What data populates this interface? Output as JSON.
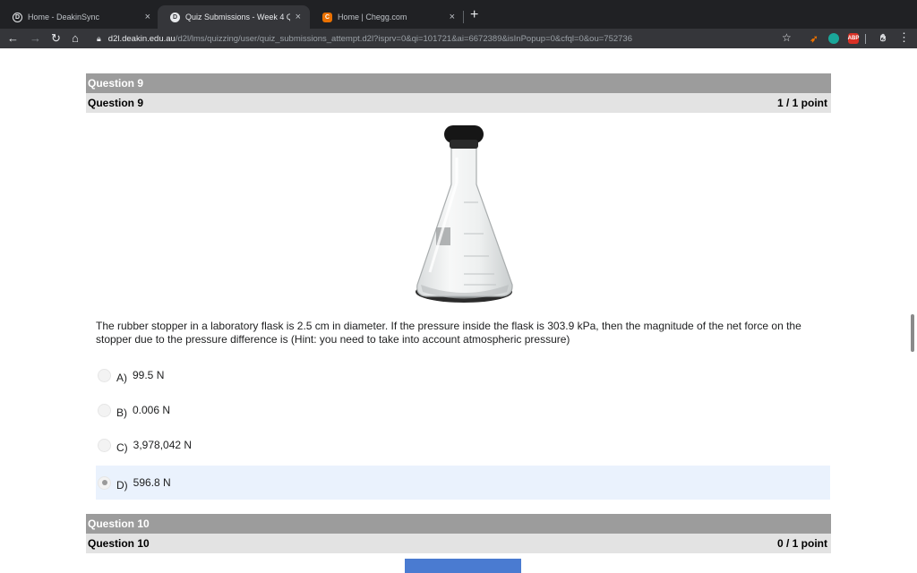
{
  "browser": {
    "tabs": [
      {
        "title": "Home - DeakinSync",
        "close": "×"
      },
      {
        "title": "Quiz Submissions - Week 4 Qu",
        "close": "×"
      },
      {
        "title": "Home | Chegg.com",
        "close": "×"
      }
    ],
    "new_tab": "+",
    "url_host": "d2l.deakin.edu.au",
    "url_path": "/d2l/lms/quizzing/user/quiz_submissions_attempt.d2l?isprv=0&qi=101721&ai=6672389&isInPopup=0&cfql=0&ou=752736",
    "ext_abp_label": "ABP"
  },
  "questions": [
    {
      "section_label": "Question 9",
      "title": "Question 9",
      "score": "1 / 1 point",
      "text": "The rubber stopper in a laboratory flask is 2.5 cm in diameter. If the pressure inside the flask is 303.9 kPa, then the magnitude of the net force on the stopper due to the pressure difference is (Hint: you need to take into account atmospheric pressure)",
      "options": [
        {
          "letter": "A)",
          "value": "99.5 N",
          "selected": false
        },
        {
          "letter": "B)",
          "value": "0.006 N",
          "selected": false
        },
        {
          "letter": "C)",
          "value": "3,978,042 N",
          "selected": false
        },
        {
          "letter": "D)",
          "value": "596.8 N",
          "selected": true
        }
      ]
    },
    {
      "section_label": "Question 10",
      "title": "Question 10",
      "score": "0 / 1 point"
    }
  ],
  "colors": {
    "header_dark": "#9c9c9c",
    "header_light": "#e3e3e3",
    "selected_row": "#eaf2fd",
    "chegg": "#eb7100"
  }
}
